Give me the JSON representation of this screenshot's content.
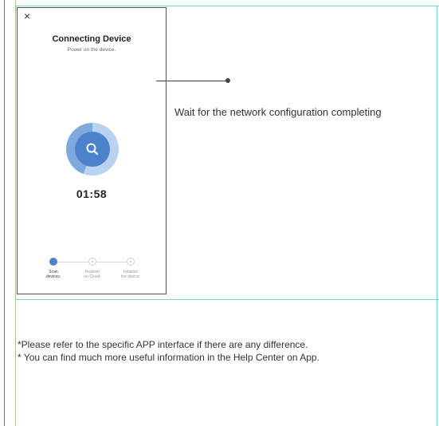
{
  "phone": {
    "close_glyph": "×",
    "title": "Connecting Device",
    "subtitle": "Power on the device.",
    "timer": "01:58",
    "steps": [
      {
        "line1": "Scan",
        "line2": "devices."
      },
      {
        "line1": "Register",
        "line2": "on Cloud."
      },
      {
        "line1": "Initialize",
        "line2": "the device."
      }
    ]
  },
  "callout": {
    "text": "Wait for the network configuration  completing"
  },
  "notes": [
    "*Please refer to the specific APP interface if there are any difference.",
    "* You can find much more useful information in the Help Center on App."
  ],
  "colors": {
    "accent": "#4c82cc",
    "frame_lines": "#6fd3e3",
    "margin_rule": "#d43ba5"
  },
  "icons": {
    "close": "close-icon",
    "search": "search-icon"
  }
}
